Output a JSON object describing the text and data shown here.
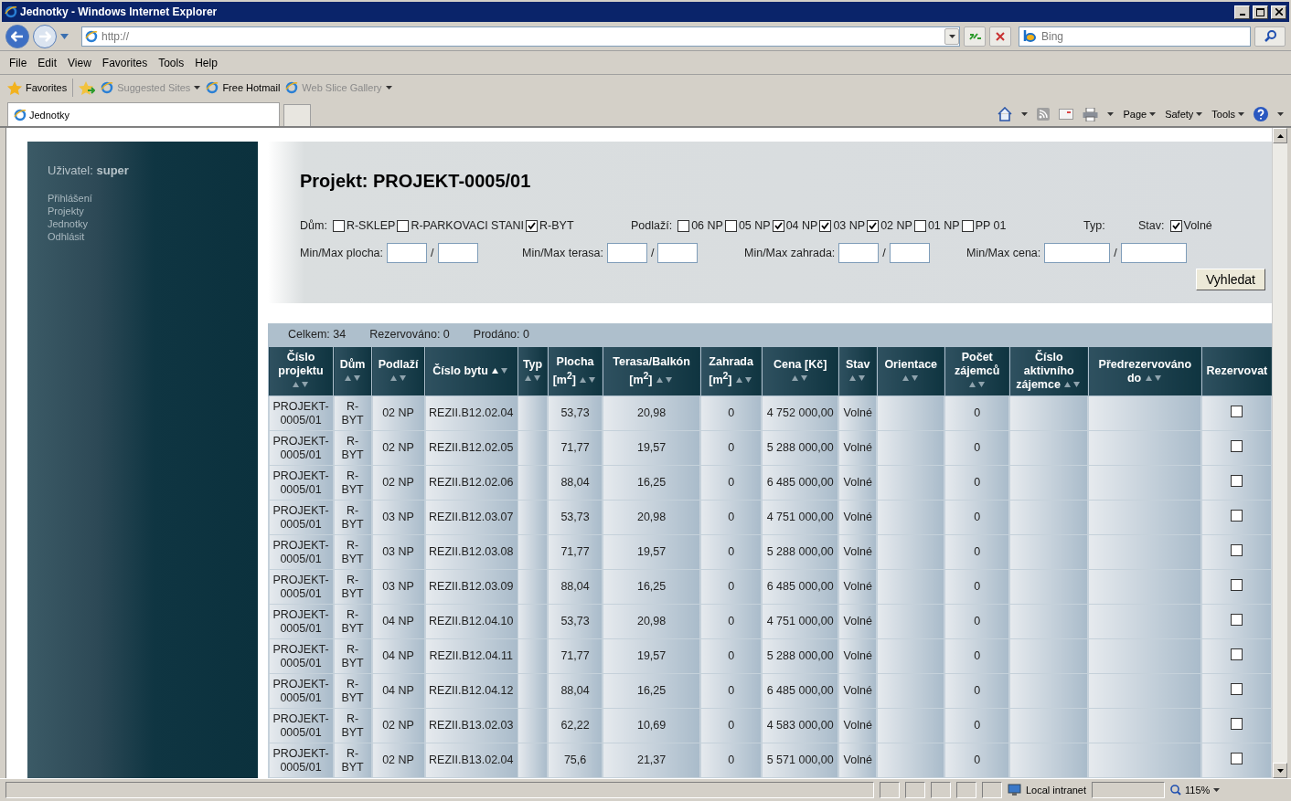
{
  "window": {
    "title": "Jednotky - Windows Internet Explorer"
  },
  "address_bar": {
    "value": "http://"
  },
  "search": {
    "placeholder": "Bing"
  },
  "menu": [
    "File",
    "Edit",
    "View",
    "Favorites",
    "Tools",
    "Help"
  ],
  "favorites_bar": [
    {
      "label": "Favorites",
      "kind": "star",
      "disabled": false,
      "dropdown": false
    },
    {
      "label": "Suggested Sites",
      "kind": "ie",
      "disabled": true,
      "dropdown": true
    },
    {
      "label": "Free Hotmail",
      "kind": "page",
      "disabled": false,
      "dropdown": false
    },
    {
      "label": "Web Slice Gallery",
      "kind": "page",
      "disabled": true,
      "dropdown": true
    }
  ],
  "tabs": [
    {
      "label": "Jednotky",
      "selected": true
    }
  ],
  "command_bar": [
    "Page",
    "Safety",
    "Tools"
  ],
  "sidebar": {
    "user_label": "Uživatel:",
    "user_name": "super",
    "links": [
      "Přihlášení",
      "Projekty",
      "Jednotky",
      "Odhlásit"
    ]
  },
  "filter": {
    "title": "Projekt: PROJEKT-0005/01",
    "groups": [
      {
        "label": "Dům:",
        "options": [
          {
            "label": "R-SKLEP",
            "checked": false
          },
          {
            "label": "R-PARKOVACI STANI",
            "checked": false
          },
          {
            "label": "R-BYT",
            "checked": true
          }
        ]
      },
      {
        "label": "Podlaží:",
        "options": [
          {
            "label": "06 NP",
            "checked": false
          },
          {
            "label": "05 NP",
            "checked": false
          },
          {
            "label": "04 NP",
            "checked": true
          },
          {
            "label": "03 NP",
            "checked": true
          },
          {
            "label": "02 NP",
            "checked": true
          },
          {
            "label": "01 NP",
            "checked": false
          },
          {
            "label": "PP 01",
            "checked": false
          }
        ]
      },
      {
        "label": "Typ:"
      },
      {
        "label": "Stav:",
        "options": [
          {
            "label": "Volné",
            "checked": true
          }
        ]
      }
    ],
    "ranges": [
      {
        "label": "Min/Max plocha:",
        "separator": "/"
      },
      {
        "label": "Min/Max terasa:",
        "separator": "/"
      },
      {
        "label": "Min/Max zahrada:",
        "separator": "/"
      },
      {
        "label": "Min/Max cena:",
        "separator": "/"
      }
    ],
    "search_button": "Vyhledat"
  },
  "summary": [
    "Celkem: 34",
    "Rezervováno: 0",
    "Prodáno: 0"
  ],
  "table": {
    "columns": [
      {
        "label": "Číslo projektu",
        "sort_active": false
      },
      {
        "label": "Dům",
        "sort_active": false
      },
      {
        "label": "Podlaží",
        "sort_active": false
      },
      {
        "label": "Číslo bytu",
        "sort_active": true
      },
      {
        "label": "Typ",
        "sort_active": false
      },
      {
        "label": "Plocha [m$^{2}$]",
        "sort_active": false
      },
      {
        "label": "Terasa/Balkón [m$^{2}$]",
        "sort_active": false
      },
      {
        "label": "Zahrada [m$^{2}$]",
        "sort_active": false
      },
      {
        "label": "Cena [Kč]",
        "sort_active": false
      },
      {
        "label": "Stav",
        "sort_active": false
      },
      {
        "label": "Orientace",
        "sort_active": false
      },
      {
        "label": "Počet zájemců",
        "sort_active": false
      },
      {
        "label": "Číslo aktivního zájemce",
        "sort_active": false
      },
      {
        "label": "Předrezervováno do",
        "sort_active": false
      },
      {
        "label": "Rezervovat"
      }
    ],
    "rows": [
      {
        "cells": [
          "PROJEKT-0005/01",
          "R-BYT",
          "02 NP",
          "REZII.B12.02.04",
          "",
          "53,73",
          "20,98",
          "0",
          "4 752 000,00",
          "Volné",
          "",
          "0",
          "",
          ""
        ],
        "reserved": false
      },
      {
        "cells": [
          "PROJEKT-0005/01",
          "R-BYT",
          "02 NP",
          "REZII.B12.02.05",
          "",
          "71,77",
          "19,57",
          "0",
          "5 288 000,00",
          "Volné",
          "",
          "0",
          "",
          ""
        ],
        "reserved": false
      },
      {
        "cells": [
          "PROJEKT-0005/01",
          "R-BYT",
          "02 NP",
          "REZII.B12.02.06",
          "",
          "88,04",
          "16,25",
          "0",
          "6 485 000,00",
          "Volné",
          "",
          "0",
          "",
          ""
        ],
        "reserved": false
      },
      {
        "cells": [
          "PROJEKT-0005/01",
          "R-BYT",
          "03 NP",
          "REZII.B12.03.07",
          "",
          "53,73",
          "20,98",
          "0",
          "4 751 000,00",
          "Volné",
          "",
          "0",
          "",
          ""
        ],
        "reserved": false
      },
      {
        "cells": [
          "PROJEKT-0005/01",
          "R-BYT",
          "03 NP",
          "REZII.B12.03.08",
          "",
          "71,77",
          "19,57",
          "0",
          "5 288 000,00",
          "Volné",
          "",
          "0",
          "",
          ""
        ],
        "reserved": false
      },
      {
        "cells": [
          "PROJEKT-0005/01",
          "R-BYT",
          "03 NP",
          "REZII.B12.03.09",
          "",
          "88,04",
          "16,25",
          "0",
          "6 485 000,00",
          "Volné",
          "",
          "0",
          "",
          ""
        ],
        "reserved": false
      },
      {
        "cells": [
          "PROJEKT-0005/01",
          "R-BYT",
          "04 NP",
          "REZII.B12.04.10",
          "",
          "53,73",
          "20,98",
          "0",
          "4 751 000,00",
          "Volné",
          "",
          "0",
          "",
          ""
        ],
        "reserved": false
      },
      {
        "cells": [
          "PROJEKT-0005/01",
          "R-BYT",
          "04 NP",
          "REZII.B12.04.11",
          "",
          "71,77",
          "19,57",
          "0",
          "5 288 000,00",
          "Volné",
          "",
          "0",
          "",
          ""
        ],
        "reserved": false
      },
      {
        "cells": [
          "PROJEKT-0005/01",
          "R-BYT",
          "04 NP",
          "REZII.B12.04.12",
          "",
          "88,04",
          "16,25",
          "0",
          "6 485 000,00",
          "Volné",
          "",
          "0",
          "",
          ""
        ],
        "reserved": false
      },
      {
        "cells": [
          "PROJEKT-0005/01",
          "R-BYT",
          "02 NP",
          "REZII.B13.02.03",
          "",
          "62,22",
          "10,69",
          "0",
          "4 583 000,00",
          "Volné",
          "",
          "0",
          "",
          ""
        ],
        "reserved": false
      },
      {
        "cells": [
          "PROJEKT-0005/01",
          "R-BYT",
          "02 NP",
          "REZII.B13.02.04",
          "",
          "75,6",
          "21,37",
          "0",
          "5 571 000,00",
          "Volné",
          "",
          "0",
          "",
          ""
        ],
        "reserved": false
      }
    ]
  },
  "status_bar": {
    "zone": "Local intranet",
    "zoom": "115%"
  }
}
